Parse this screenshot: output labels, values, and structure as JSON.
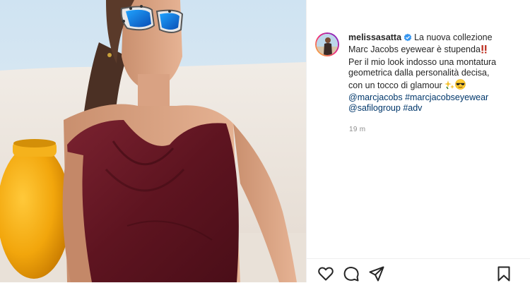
{
  "post": {
    "username": "melissasatta",
    "caption_lines": [
      "La nuova collezione",
      "Marc Jacobs eyewear è stupenda",
      "Per il mio look indosso una montatura",
      "geometrica dalla personalità decisa,",
      "con un tocco di glamour"
    ],
    "hashtags_line1": "@marcjacobs #marcjacobseyewear",
    "hashtags_line2": "@safilogroup #adv",
    "timestamp": "19 m"
  },
  "icons": {
    "verified": "verified-badge-icon",
    "exclamation": "double-exclamation-icon",
    "sparkle": "sparkles-icon",
    "sunglasses_emoji": "sunglasses-face-icon",
    "like": "heart-icon",
    "comment": "comment-icon",
    "share": "share-icon",
    "save": "bookmark-icon"
  },
  "colors": {
    "link": "#00376b",
    "verified": "#3897f0",
    "text": "#262626",
    "muted": "#8e8e8e"
  }
}
